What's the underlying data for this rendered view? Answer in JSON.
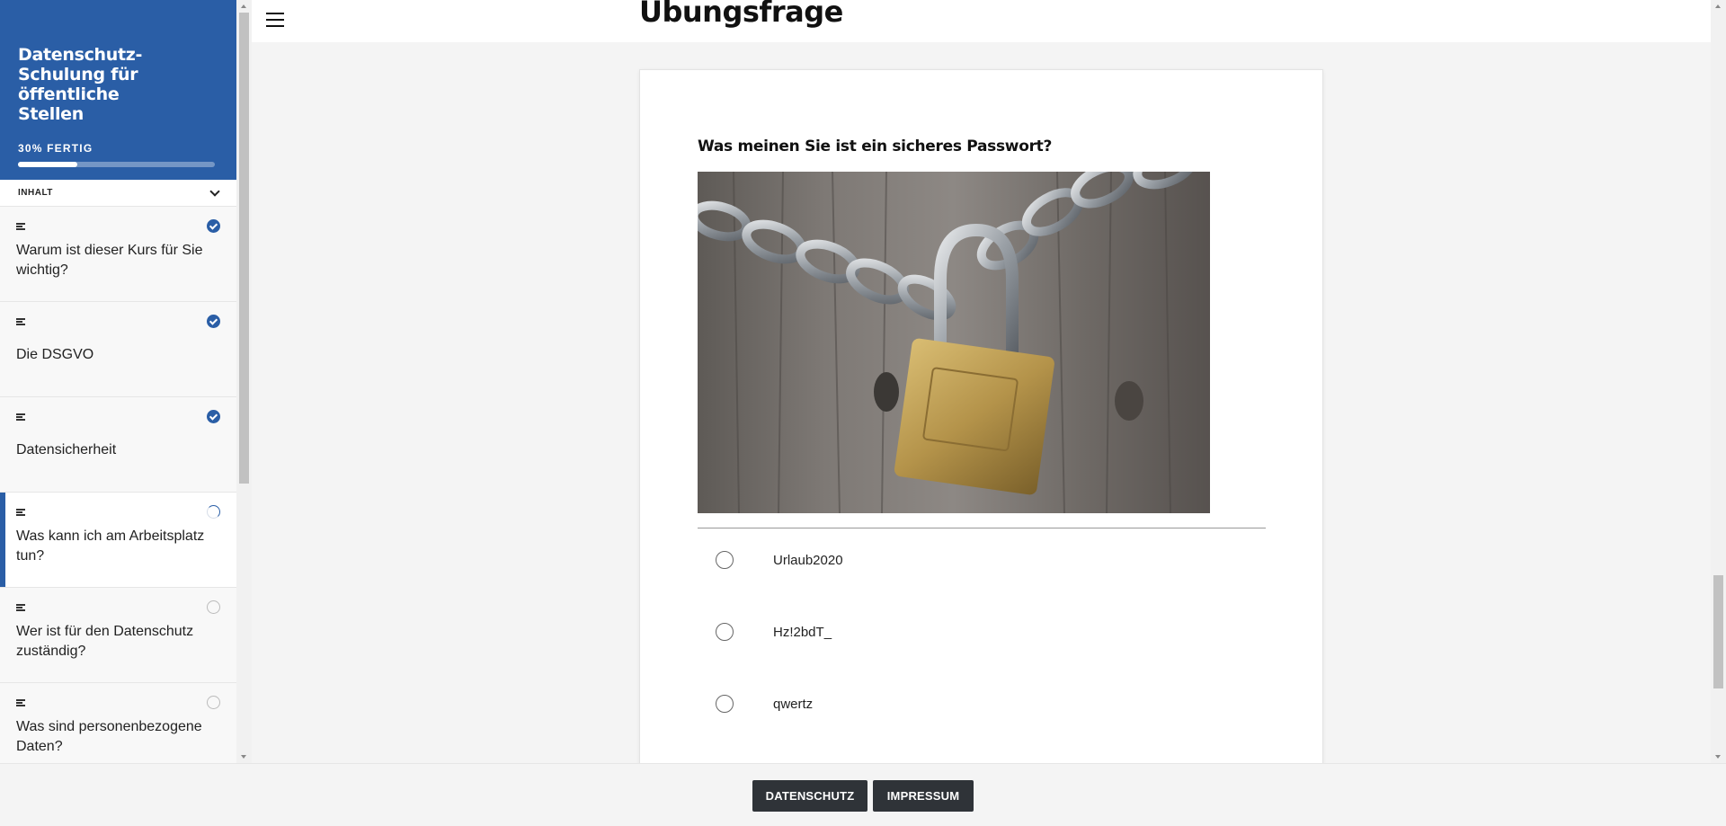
{
  "sidebar": {
    "course_title": "Datenschutz-Schulung für öffentliche Stellen",
    "progress_label": "30% FERTIG",
    "progress_fraction": 0.3,
    "contents_label": "INHALT",
    "lessons": [
      {
        "label": "Warum ist dieser Kurs für Sie wichtig?",
        "status": "completed"
      },
      {
        "label": "Die DSGVO",
        "status": "completed"
      },
      {
        "label": "Datensicherheit",
        "status": "completed"
      },
      {
        "label": "Was kann ich am Arbeitsplatz tun?",
        "status": "in-progress"
      },
      {
        "label": "Wer ist für den Datenschutz zuständig?",
        "status": "not-started"
      },
      {
        "label": "Was sind personenbezogene Daten?",
        "status": "not-started"
      }
    ]
  },
  "header": {
    "page_title": "Übungsfrage"
  },
  "quiz": {
    "question": "Was meinen Sie ist ein sicheres Passwort?",
    "image_subject": "padlock-on-chain",
    "options": [
      {
        "label": "Urlaub2020"
      },
      {
        "label": "Hz!2bdT_"
      },
      {
        "label": "qwertz"
      }
    ]
  },
  "footer": {
    "privacy_button": "DATENSCHUTZ",
    "imprint_button": "IMPRESSUM"
  },
  "colors": {
    "brand": "#2a5ea6",
    "footer_button": "#2f3338"
  }
}
